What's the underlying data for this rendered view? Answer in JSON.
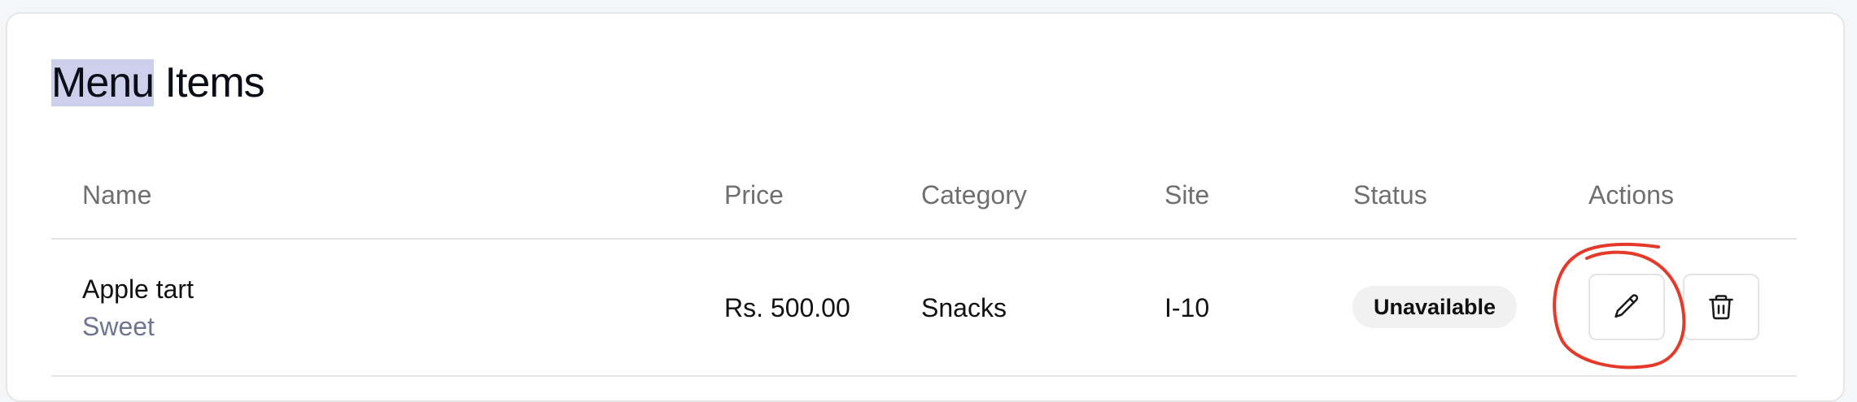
{
  "page": {
    "title_highlight": "Menu",
    "title_rest": " Items"
  },
  "table": {
    "headers": {
      "name": "Name",
      "price": "Price",
      "category": "Category",
      "site": "Site",
      "status": "Status",
      "actions": "Actions"
    },
    "rows": [
      {
        "name": "Apple tart",
        "subtitle": "Sweet",
        "price": "Rs. 500.00",
        "category": "Snacks",
        "site": "I-10",
        "status": "Unavailable"
      }
    ]
  },
  "icons": {
    "edit": "pencil-icon",
    "delete": "trash-icon"
  },
  "colors": {
    "title_highlight": "#cdd0ea",
    "annotation": "#e5392a",
    "badge_bg": "#f1f1f2",
    "subtitle": "#6e7590"
  }
}
